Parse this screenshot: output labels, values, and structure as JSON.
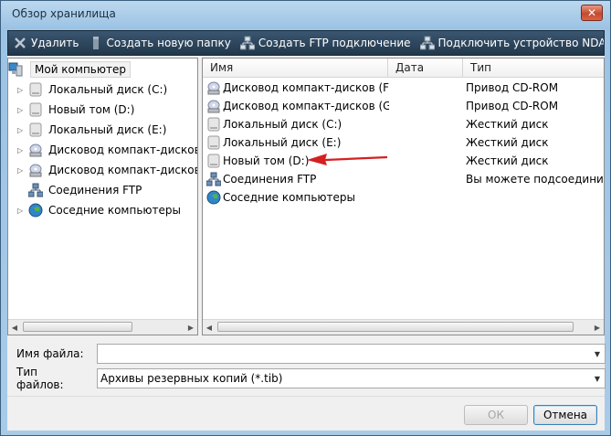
{
  "window": {
    "title": "Обзор хранилища",
    "close_glyph": "✕"
  },
  "toolbar": {
    "buttons": [
      {
        "label": "Удалить",
        "icon": "delete-icon"
      },
      {
        "label": "Создать новую папку",
        "icon": "new-folder-icon"
      },
      {
        "label": "Создать FTP подключение",
        "icon": "ftp-connection-icon"
      },
      {
        "label": "Подключить устройство NDAS",
        "icon": "ndas-device-icon"
      }
    ]
  },
  "tree": {
    "root": {
      "label": "Мой компьютер",
      "icon": "computer-icon"
    },
    "items": [
      {
        "label": "Локальный диск (C:)",
        "icon": "drive-icon",
        "expandable": true
      },
      {
        "label": "Новый том (D:)",
        "icon": "drive-icon",
        "expandable": true
      },
      {
        "label": "Локальный диск (E:)",
        "icon": "drive-icon",
        "expandable": true
      },
      {
        "label": "Дисковод компакт-дисков (F:)",
        "icon": "cdrom-icon",
        "expandable": true
      },
      {
        "label": "Дисковод компакт-дисков (G:)",
        "icon": "cdrom-icon",
        "expandable": true
      },
      {
        "label": "Соединения FTP",
        "icon": "ftp-icon",
        "expandable": false
      },
      {
        "label": "Соседние компьютеры",
        "icon": "network-icon",
        "expandable": true
      }
    ]
  },
  "list": {
    "columns": [
      "Имя",
      "Дата",
      "Тип"
    ],
    "rows": [
      {
        "name": "Дисковод компакт-дисков (F:)",
        "type": "Привод CD-ROM",
        "icon": "cdrom-icon"
      },
      {
        "name": "Дисковод компакт-дисков (G:)",
        "type": "Привод CD-ROM",
        "icon": "cdrom-icon"
      },
      {
        "name": "Локальный диск (C:)",
        "type": "Жесткий диск",
        "icon": "drive-icon"
      },
      {
        "name": "Локальный диск (E:)",
        "type": "Жесткий диск",
        "icon": "drive-icon"
      },
      {
        "name": "Новый том (D:)",
        "type": "Жесткий диск",
        "icon": "drive-icon"
      },
      {
        "name": "Соединения FTP",
        "type": "Вы можете подсоединиться",
        "icon": "ftp-icon"
      },
      {
        "name": "Соседние компьютеры",
        "type": "",
        "icon": "network-icon"
      }
    ]
  },
  "filename": {
    "label": "Имя файла:",
    "value": ""
  },
  "filetype": {
    "label": "Тип файлов:",
    "value": "Архивы резервных копий (*.tib)"
  },
  "buttons": {
    "ok": "ОК",
    "cancel": "Отмена"
  },
  "colors": {
    "accent_arrow": "#d42020",
    "toolbar_bg": "#2d465c"
  }
}
